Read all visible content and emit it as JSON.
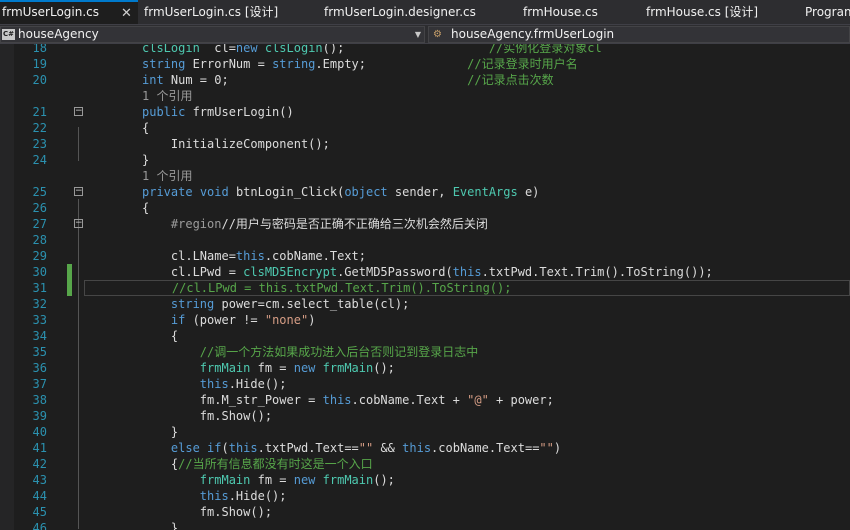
{
  "tabs": [
    {
      "label": "frmUserLogin.cs",
      "active": true,
      "close": "✕"
    },
    {
      "label": "frmUserLogin.cs [设计]"
    },
    {
      "label": "frmUserLogin.designer.cs"
    },
    {
      "label": "frmHouse.cs"
    },
    {
      "label": "frmHouse.cs [设计]"
    },
    {
      "label": "Program"
    }
  ],
  "nav": {
    "project_badge": "C#",
    "project": "houseAgency",
    "member": "houseAgency.frmUserLogin"
  },
  "code_lines": [
    {
      "num": "18",
      "tokens": [
        [
          "ty",
          "clsLogin"
        ],
        [
          "",
          "  cl="
        ],
        [
          "kw",
          "new"
        ],
        [
          "",
          " "
        ],
        [
          "ty",
          "clsLogin"
        ],
        [
          "",
          "();"
        ],
        [
          "",
          "                    "
        ],
        [
          "cm",
          "//实例化登录对象cl"
        ]
      ]
    },
    {
      "num": "19",
      "tokens": [
        [
          "kw",
          "string"
        ],
        [
          "",
          " ErrorNum = "
        ],
        [
          "kw",
          "string"
        ],
        [
          "",
          ".Empty;"
        ],
        [
          "",
          "              "
        ],
        [
          "cm",
          "//记录登录时用户名"
        ]
      ]
    },
    {
      "num": "20",
      "tokens": [
        [
          "kw",
          "int"
        ],
        [
          "",
          " Num = 0;"
        ],
        [
          "",
          "                                 "
        ],
        [
          "cm",
          "//记录点击次数"
        ]
      ]
    },
    {
      "num": "",
      "ref": true,
      "tokens": [
        [
          "ref",
          "1 个引用"
        ]
      ]
    },
    {
      "num": "21",
      "fold": true,
      "tokens": [
        [
          "kw",
          "public"
        ],
        [
          "",
          " frmUserLogin()"
        ]
      ]
    },
    {
      "num": "22",
      "tokens": [
        [
          "",
          "{"
        ]
      ]
    },
    {
      "num": "23",
      "tokens": [
        [
          "",
          "    InitializeComponent();"
        ]
      ]
    },
    {
      "num": "24",
      "tokens": [
        [
          "",
          "}"
        ]
      ]
    },
    {
      "num": "",
      "ref": true,
      "tokens": [
        [
          "ref",
          "1 个引用"
        ]
      ]
    },
    {
      "num": "25",
      "fold": true,
      "tokens": [
        [
          "kw",
          "private"
        ],
        [
          "",
          " "
        ],
        [
          "kw",
          "void"
        ],
        [
          "",
          " btnLogin_Click("
        ],
        [
          "kw",
          "object"
        ],
        [
          "",
          " sender, "
        ],
        [
          "ty",
          "EventArgs"
        ],
        [
          "",
          " e)"
        ]
      ]
    },
    {
      "num": "26",
      "tokens": [
        [
          "",
          "{"
        ]
      ]
    },
    {
      "num": "27",
      "fold": true,
      "tokens": [
        [
          "",
          "    "
        ],
        [
          "rg",
          "#region"
        ],
        [
          "",
          "//用户与密码是否正确不正确给三次机会然后关闭"
        ]
      ]
    },
    {
      "num": "28",
      "tokens": []
    },
    {
      "num": "29",
      "tokens": [
        [
          "",
          "    cl.LName="
        ],
        [
          "kw",
          "this"
        ],
        [
          "",
          ".cobName.Text;"
        ]
      ]
    },
    {
      "num": "30",
      "changed": true,
      "tokens": [
        [
          "",
          "    cl.LPwd = "
        ],
        [
          "ty",
          "clsMD5Encrypt"
        ],
        [
          "",
          ".GetMD5Password("
        ],
        [
          "kw",
          "this"
        ],
        [
          "",
          ".txtPwd.Text.Trim().ToString());"
        ]
      ]
    },
    {
      "num": "31",
      "changed": true,
      "highlight": true,
      "tokens": [
        [
          "",
          "    "
        ],
        [
          "cm",
          "//cl.LPwd = this.txtPwd.Text.Trim().ToString();"
        ]
      ]
    },
    {
      "num": "32",
      "tokens": [
        [
          "",
          "    "
        ],
        [
          "kw",
          "string"
        ],
        [
          "",
          " power=cm.select_table(cl);"
        ]
      ]
    },
    {
      "num": "33",
      "tokens": [
        [
          "",
          "    "
        ],
        [
          "kw",
          "if"
        ],
        [
          "",
          " (power != "
        ],
        [
          "st",
          "\"none\""
        ],
        [
          "",
          ")"
        ]
      ]
    },
    {
      "num": "34",
      "tokens": [
        [
          "",
          "    {"
        ]
      ]
    },
    {
      "num": "35",
      "tokens": [
        [
          "",
          "        "
        ],
        [
          "cm",
          "//调一个方法如果成功进入后台否则记到登录日志中"
        ]
      ]
    },
    {
      "num": "36",
      "tokens": [
        [
          "",
          "        "
        ],
        [
          "ty",
          "frmMain"
        ],
        [
          "",
          " fm = "
        ],
        [
          "kw",
          "new"
        ],
        [
          "",
          " "
        ],
        [
          "ty",
          "frmMain"
        ],
        [
          "",
          "();"
        ]
      ]
    },
    {
      "num": "37",
      "tokens": [
        [
          "",
          "        "
        ],
        [
          "kw",
          "this"
        ],
        [
          "",
          ".Hide();"
        ]
      ]
    },
    {
      "num": "38",
      "tokens": [
        [
          "",
          "        fm.M_str_Power = "
        ],
        [
          "kw",
          "this"
        ],
        [
          "",
          ".cobName.Text + "
        ],
        [
          "st",
          "\"@\""
        ],
        [
          "",
          " + power;"
        ]
      ]
    },
    {
      "num": "39",
      "tokens": [
        [
          "",
          "        fm.Show();"
        ]
      ]
    },
    {
      "num": "40",
      "tokens": [
        [
          "",
          "    }"
        ]
      ]
    },
    {
      "num": "41",
      "tokens": [
        [
          "",
          "    "
        ],
        [
          "kw",
          "else if"
        ],
        [
          "",
          "("
        ],
        [
          "kw",
          "this"
        ],
        [
          "",
          ".txtPwd.Text=="
        ],
        [
          "st",
          "\"\""
        ],
        [
          "",
          " && "
        ],
        [
          "kw",
          "this"
        ],
        [
          "",
          ".cobName.Text=="
        ],
        [
          "st",
          "\"\""
        ],
        [
          "",
          ")"
        ]
      ]
    },
    {
      "num": "42",
      "tokens": [
        [
          "",
          "    {"
        ],
        [
          "cm",
          "//当所有信息都没有时这是一个入口"
        ]
      ]
    },
    {
      "num": "43",
      "tokens": [
        [
          "",
          "        "
        ],
        [
          "ty",
          "frmMain"
        ],
        [
          "",
          " fm = "
        ],
        [
          "kw",
          "new"
        ],
        [
          "",
          " "
        ],
        [
          "ty",
          "frmMain"
        ],
        [
          "",
          "();"
        ]
      ]
    },
    {
      "num": "44",
      "tokens": [
        [
          "",
          "        "
        ],
        [
          "kw",
          "this"
        ],
        [
          "",
          ".Hide();"
        ]
      ]
    },
    {
      "num": "45",
      "tokens": [
        [
          "",
          "        fm.Show();"
        ]
      ]
    },
    {
      "num": "46",
      "tokens": [
        [
          "",
          "    }"
        ]
      ]
    }
  ]
}
